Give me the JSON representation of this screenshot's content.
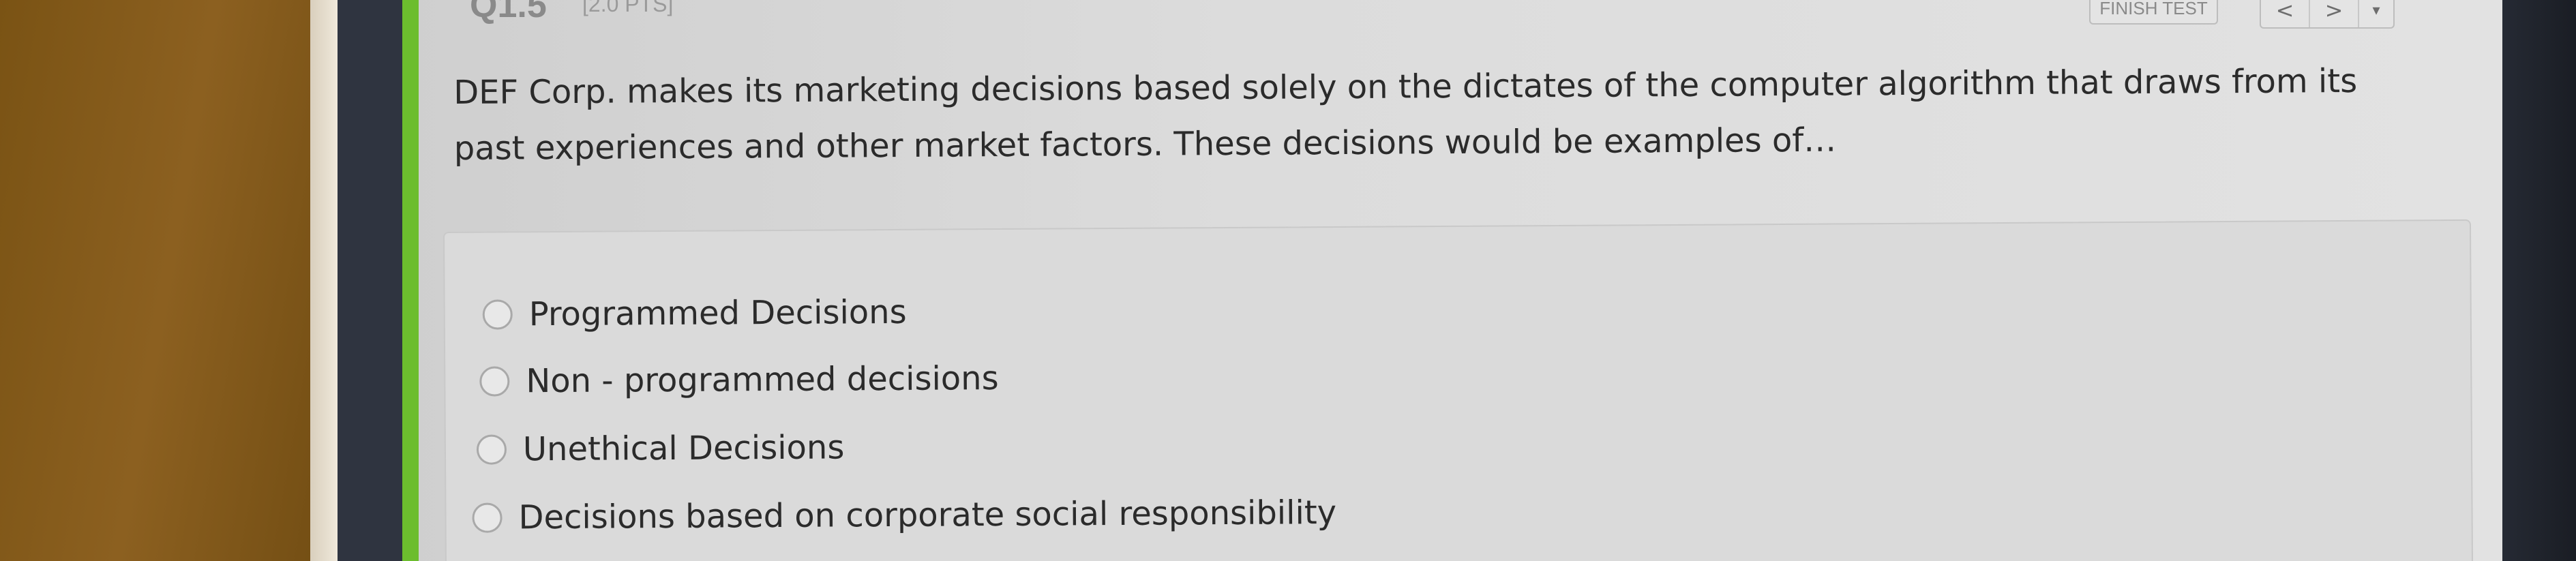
{
  "header": {
    "question_number": "Q1.5",
    "points": "[2.0 PTS]",
    "finish_label": "FINISH TEST",
    "prev_icon": "chevron-left-icon",
    "next_icon": "chevron-right-icon",
    "menu_icon": "caret-down-icon",
    "prev_glyph": "<",
    "next_glyph": ">",
    "menu_glyph": "▾"
  },
  "question": {
    "text": "DEF Corp. makes its marketing decisions based solely on the dictates of the computer algorithm that draws from its past experiences and other market factors. These decisions would be examples of…"
  },
  "answers": [
    {
      "label": "Programmed Decisions",
      "selected": false
    },
    {
      "label": "Non - programmed decisions",
      "selected": false
    },
    {
      "label": "Unethical Decisions",
      "selected": false
    },
    {
      "label": "Decisions based on corporate social responsibility",
      "selected": false
    }
  ],
  "colors": {
    "accent": "#6cbd2e",
    "text": "#2b2b2b"
  }
}
